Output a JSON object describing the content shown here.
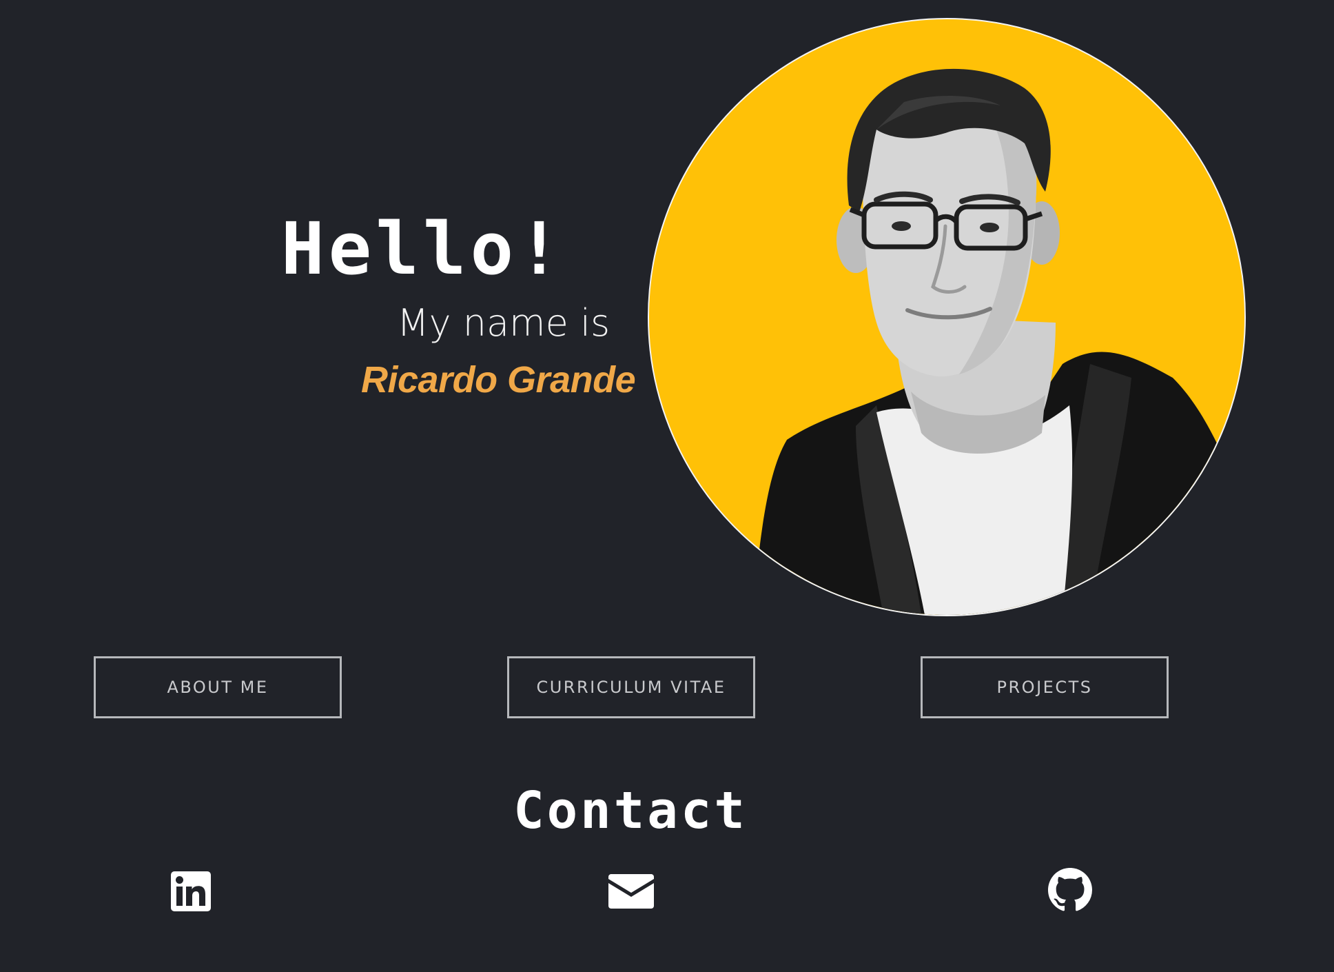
{
  "hero": {
    "greeting": "Hello!",
    "intro": "My name is",
    "name": "Ricardo Grande",
    "portrait_alt": "Ricardo Grande portrait",
    "portrait_bg": "#ffc107"
  },
  "nav": {
    "about_label": "ABOUT ME",
    "cv_label": "CURRICULUM VITAE",
    "projects_label": "PROJECTS"
  },
  "contact": {
    "title": "Contact",
    "links": [
      {
        "label": "LinkedIn",
        "icon": "linkedin-icon"
      },
      {
        "label": "Email",
        "icon": "envelope-icon"
      },
      {
        "label": "GitHub",
        "icon": "github-icon"
      }
    ]
  },
  "colors": {
    "background": "#212329",
    "accent": "#f0a848",
    "button_border": "#b6b8bb",
    "text": "#ffffff"
  }
}
